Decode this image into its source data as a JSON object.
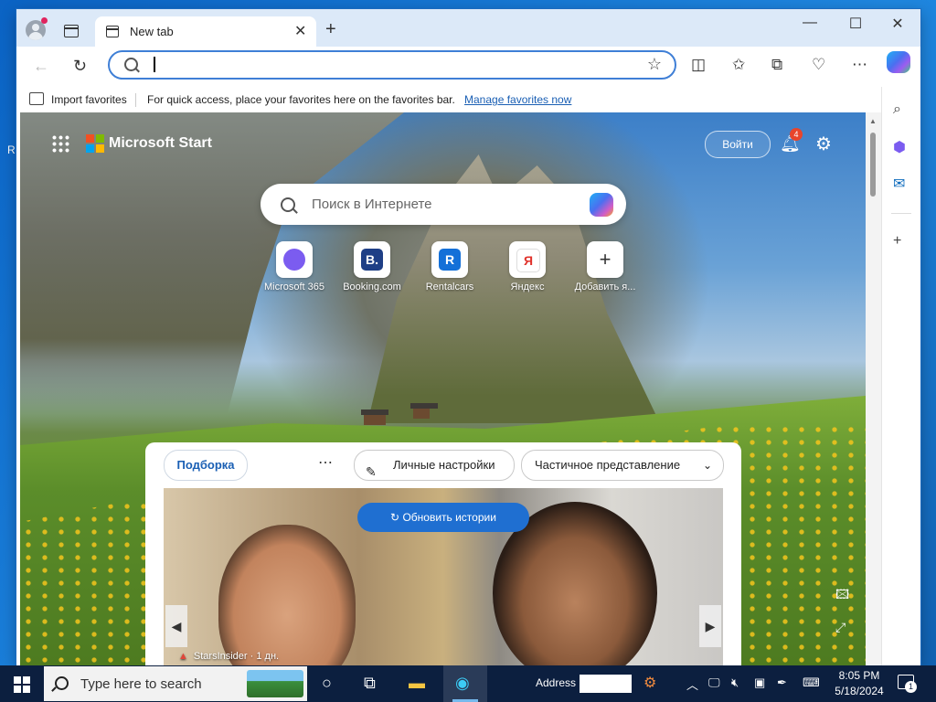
{
  "desktop": {
    "edge_letter": "R"
  },
  "browser": {
    "tab": {
      "label": "New tab"
    },
    "address": {
      "value": ""
    },
    "favorites_bar": {
      "import_label": "Import favorites",
      "quick_text": "For quick access, place your favorites here on the favorites bar.",
      "manage_link": "Manage favorites now"
    }
  },
  "newtab": {
    "brand": "Microsoft Start",
    "login_label": "Войти",
    "notification_count": "4",
    "search_placeholder": "Поиск в Интернете",
    "tiles": [
      {
        "label": "Microsoft 365",
        "icon": "m365-icon",
        "color": "#7b5cf0"
      },
      {
        "label": "Booking.com",
        "icon": "booking-icon",
        "glyph": "B.",
        "color": "#1e3f86"
      },
      {
        "label": "Rentalcars",
        "icon": "rentalcars-icon",
        "glyph": "R",
        "color": "#1470d8"
      },
      {
        "label": "Яндекс",
        "icon": "yandex-icon",
        "glyph": "Я",
        "color": "#e0322b"
      },
      {
        "label": "Добавить я...",
        "icon": "add-icon",
        "glyph": "+",
        "color": "#333333"
      }
    ],
    "feed": {
      "tab_active": "Подборка",
      "personalize_label": "Личные настройки",
      "view_label": "Частичное представление",
      "refresh_label": "Обновить истории",
      "story_source": "StarsInsider · 1 дн."
    }
  },
  "taskbar": {
    "search_placeholder": "Type here to search",
    "address_label": "Address",
    "time": "8:05 PM",
    "date": "5/18/2024",
    "notification_count": "1"
  }
}
